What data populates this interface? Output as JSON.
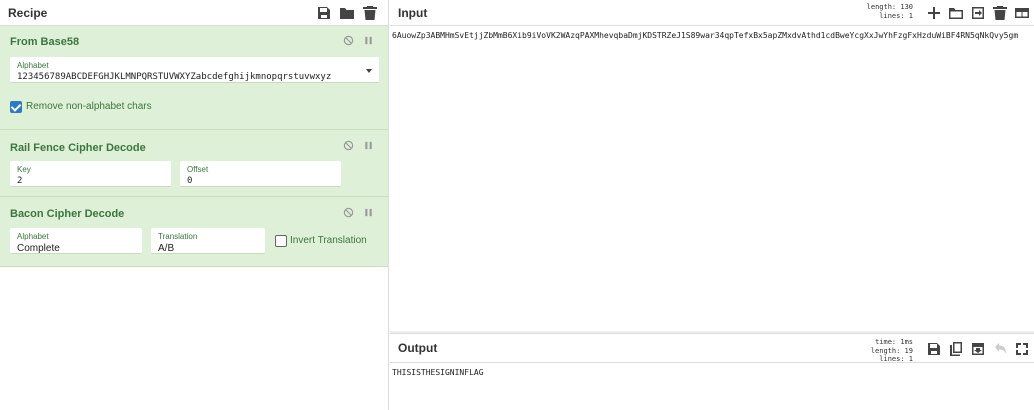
{
  "recipe": {
    "title": "Recipe",
    "operations": [
      {
        "name": "From Base58",
        "alphabet_label": "Alphabet",
        "alphabet_value": "123456789ABCDEFGHJKLMNPQRSTUVWXYZabcdefghijkmnopqrstuvwxyz",
        "remove_label": "Remove non-alphabet chars",
        "remove_checked": true
      },
      {
        "name": "Rail Fence Cipher Decode",
        "key_label": "Key",
        "key_value": "2",
        "offset_label": "Offset",
        "offset_value": "0"
      },
      {
        "name": "Bacon Cipher Decode",
        "alphabet_label": "Alphabet",
        "alphabet_value": "Complete",
        "translation_label": "Translation",
        "translation_value": "A/B",
        "invert_label": "Invert Translation",
        "invert_checked": false
      }
    ]
  },
  "input": {
    "title": "Input",
    "length_line": "length: 130",
    "lines_line": "lines:   1",
    "text": "6AuowZp3ABMHmSvEtjjZbMmB6Xib9iVoVK2WAzqPAXMhevqbaDmjKDSTRZeJ1S89war34qpTefxBx5apZMxdvAthd1cdBweYcgXxJwYhFzgFxHzduWiBF4RN5qNkQvy5gm"
  },
  "output": {
    "title": "Output",
    "time_line": "time:    1ms",
    "length_line": "length:   19",
    "lines_line": "lines:    1",
    "text": "THISISTHESIGNINFLAG"
  },
  "icons": {
    "recipe": [
      "save-icon",
      "folder-icon",
      "trash-icon"
    ],
    "input": [
      "plus-icon",
      "open-folder-icon",
      "import-icon",
      "trash-icon",
      "layout-icon"
    ],
    "output": [
      "save-icon",
      "copy-icon",
      "replace-input-icon",
      "undo-icon",
      "maximize-icon"
    ]
  },
  "colors": {
    "op_background": "#dff0d8",
    "op_text": "#3c763d",
    "checkbox": "#2f7ac0"
  }
}
